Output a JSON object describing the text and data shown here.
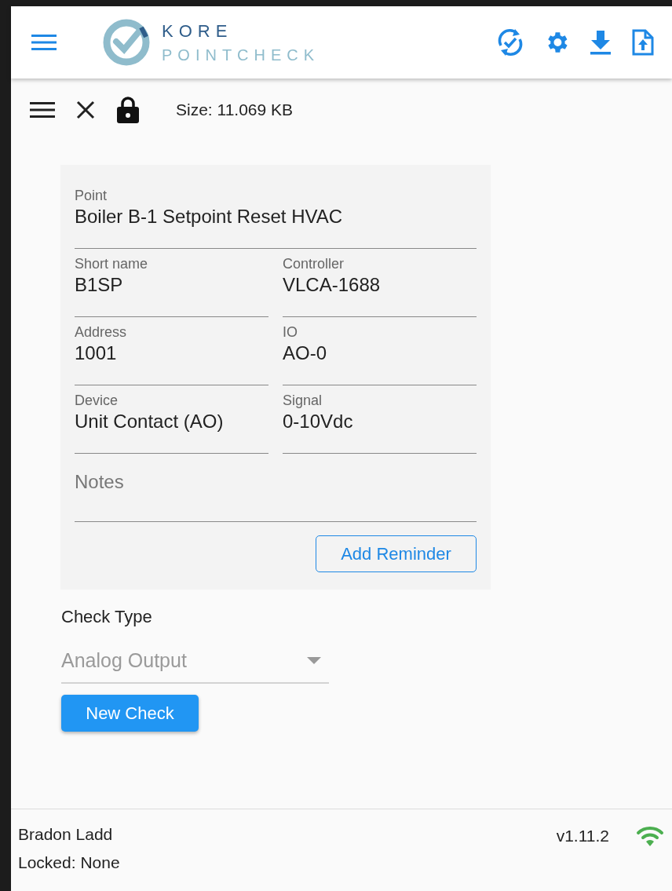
{
  "header": {
    "logo_top": "KORE",
    "logo_bottom": "POINTCHECK"
  },
  "toolbar": {
    "size": "Size: 11.069 KB"
  },
  "point": {
    "label": "Point",
    "value": "Boiler B-1 Setpoint Reset HVAC"
  },
  "fields": [
    {
      "label": "Short name",
      "value": "B1SP"
    },
    {
      "label": "Controller",
      "value": "VLCA-1688"
    },
    {
      "label": "Address",
      "value": "1001"
    },
    {
      "label": "IO",
      "value": "AO-0"
    },
    {
      "label": "Device",
      "value": "Unit Contact (AO)"
    },
    {
      "label": "Signal",
      "value": "0-10Vdc"
    }
  ],
  "notes": {
    "placeholder": "Notes"
  },
  "add_reminder": "Add Reminder",
  "check_type": {
    "label": "Check Type",
    "value": "Analog Output"
  },
  "new_check": "New Check",
  "footer": {
    "user": "Bradon Ladd",
    "locked": "Locked: None",
    "version": "v1.11.2"
  }
}
